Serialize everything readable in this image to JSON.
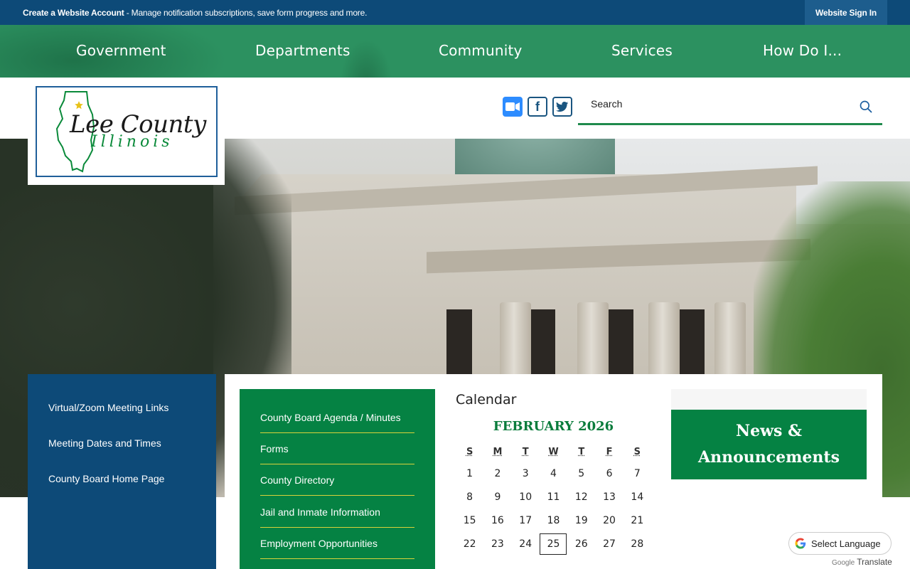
{
  "topbar": {
    "account_link": "Create a Website Account",
    "message": " - Manage notification subscriptions, save form progress and more.",
    "sign_in": "Website Sign In"
  },
  "nav": {
    "items": [
      "Government",
      "Departments",
      "Community",
      "Services",
      "How Do I..."
    ]
  },
  "logo": {
    "title": "Lee County",
    "subtitle": "Illinois"
  },
  "social": {
    "zoom": "zoom-icon",
    "facebook": "facebook-icon",
    "twitter": "twitter-icon"
  },
  "search": {
    "placeholder": "Search"
  },
  "quick_links": {
    "items": [
      "Virtual/Zoom Meeting Links",
      "Meeting Dates and Times",
      "County Board Home Page"
    ]
  },
  "green_links": {
    "items": [
      "County Board Agenda / Minutes",
      "Forms",
      "County Directory",
      "Jail and Inmate Information",
      "Employment Opportunities"
    ]
  },
  "calendar": {
    "title": "Calendar",
    "month": "FEBRUARY 2026",
    "weekdays": [
      "S",
      "M",
      "T",
      "W",
      "T",
      "F",
      "S"
    ],
    "weeks": [
      [
        "1",
        "2",
        "3",
        "4",
        "5",
        "6",
        "7"
      ],
      [
        "8",
        "9",
        "10",
        "11",
        "12",
        "13",
        "14"
      ],
      [
        "15",
        "16",
        "17",
        "18",
        "19",
        "20",
        "21"
      ],
      [
        "22",
        "23",
        "24",
        "25",
        "26",
        "27",
        "28"
      ]
    ],
    "today": "25"
  },
  "news": {
    "title": "News & Announcements"
  },
  "translate": {
    "label": "Select Language",
    "powered_brand": "Google",
    "powered_text": "Translate"
  },
  "colors": {
    "topbar": "#0d4a78",
    "nav": "#2c9160",
    "green_panel": "#058243",
    "accent_line": "#d9d23b"
  }
}
